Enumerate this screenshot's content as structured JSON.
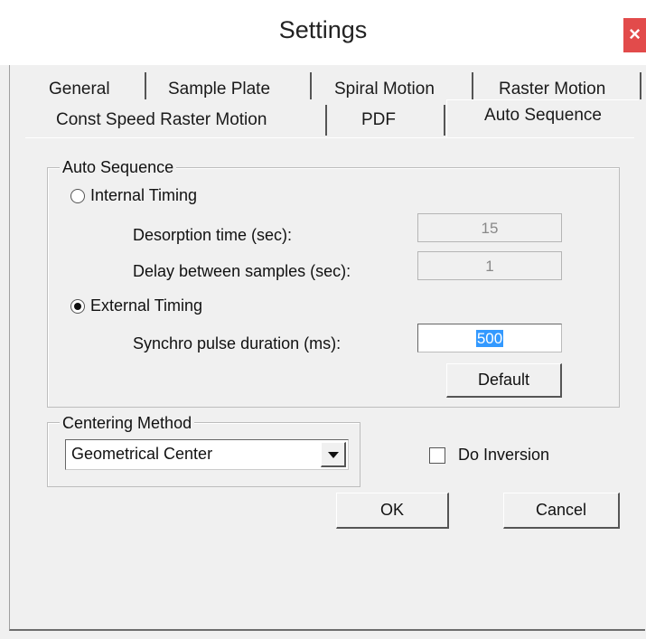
{
  "window": {
    "title": "Settings",
    "close_label": "×"
  },
  "tabs": {
    "row1": [
      "General",
      "Sample Plate",
      "Spiral Motion",
      "Raster Motion"
    ],
    "row2": [
      "Const Speed Raster Motion",
      "PDF",
      "Auto Sequence"
    ],
    "active": "Auto Sequence"
  },
  "auto_sequence": {
    "group_label": "Auto Sequence",
    "internal_timing": {
      "label": "Internal Timing",
      "selected": false,
      "desorption_label": "Desorption time (sec):",
      "desorption_value": "15",
      "delay_label": "Delay between samples (sec):",
      "delay_value": "1"
    },
    "external_timing": {
      "label": "External Timing",
      "selected": true,
      "synchro_label": "Synchro pulse duration (ms):",
      "synchro_value": "500"
    },
    "default_button": "Default"
  },
  "centering": {
    "group_label": "Centering Method",
    "selected": "Geometrical Center"
  },
  "do_inversion": {
    "label": "Do Inversion",
    "checked": false
  },
  "buttons": {
    "ok": "OK",
    "cancel": "Cancel"
  }
}
